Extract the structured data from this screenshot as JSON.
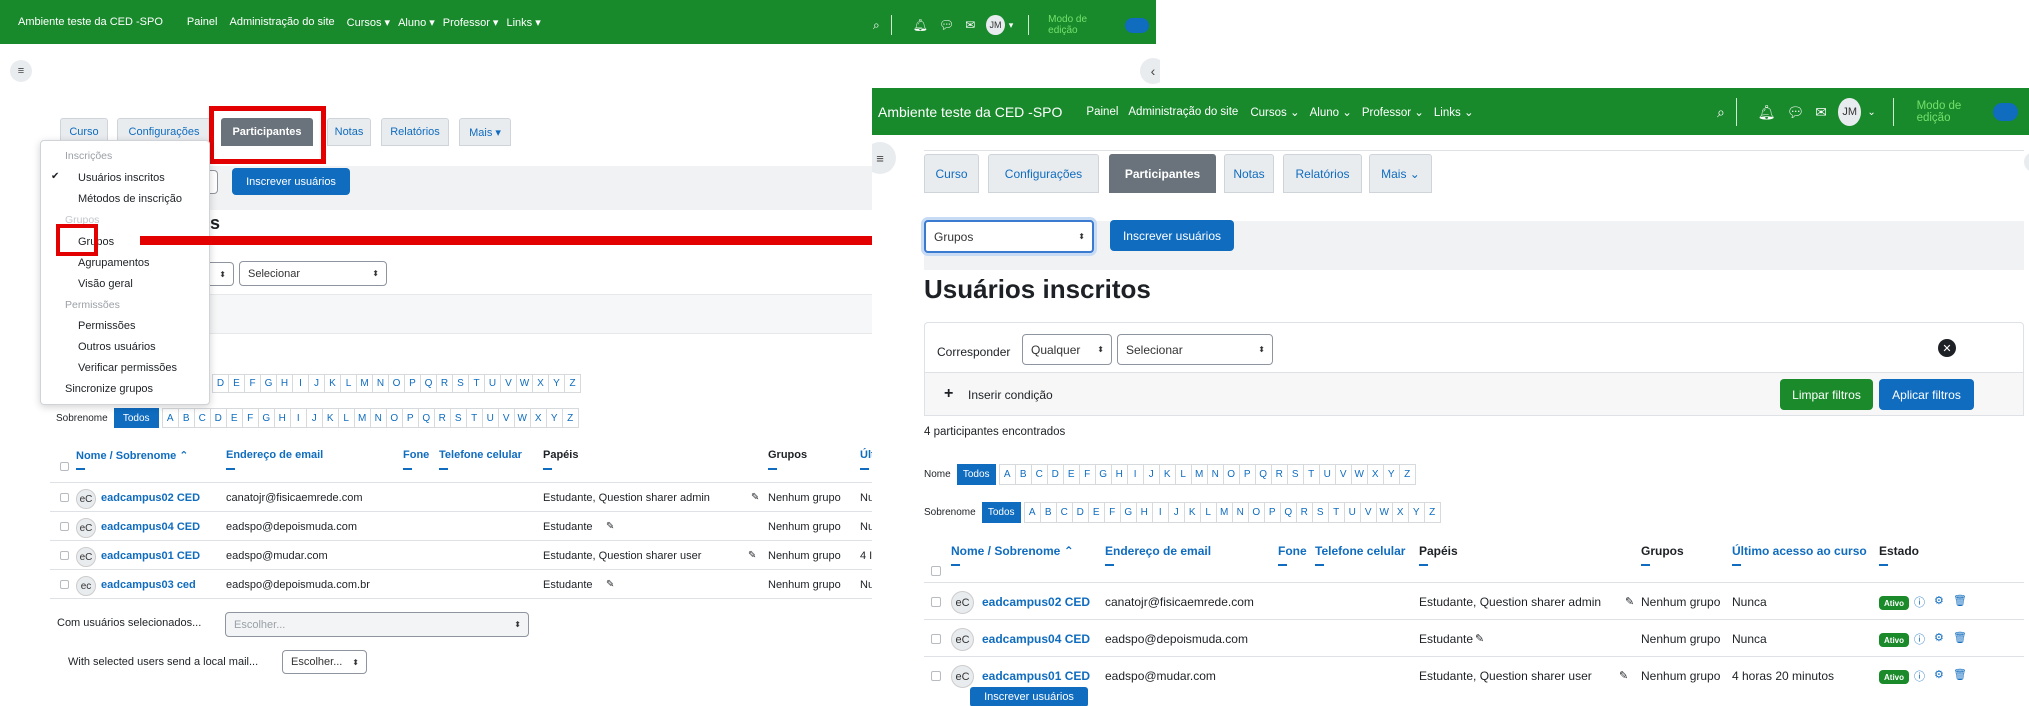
{
  "left": {
    "navbar": {
      "site_name": "Ambiente teste da CED -SPO",
      "links": [
        "Painel",
        "Administração do site",
        "Cursos ▾",
        "Aluno ▾",
        "Professor ▾",
        "Links ▾"
      ],
      "avatar": "JM",
      "edit_mode_label": "Modo de edição"
    },
    "tabs": [
      "Curso",
      "Configurações",
      "Participantes",
      "Notas",
      "Relatórios",
      "Mais ▾"
    ],
    "enrol_button": "Inscrever usuários",
    "dropdown": {
      "h1": "Inscrições",
      "i1": "Usuários inscritos",
      "i2": "Métodos de inscrição",
      "h2": "Grupos",
      "i3": "Grupos",
      "i4": "Agrupamentos",
      "i5": "Visão geral",
      "h3": "Permissões",
      "i6": "Permissões",
      "i7": "Outros usuários",
      "i8": "Verificar permissões",
      "i9": "Sincronize grupos"
    },
    "heading_tail": "s",
    "select_placeholder": "Selecionar",
    "surname_label": "Sobrenome",
    "todos": "Todos",
    "letters_partial": [
      "D",
      "E",
      "F",
      "G",
      "H",
      "I",
      "J",
      "K",
      "L",
      "M",
      "N",
      "O",
      "P",
      "Q",
      "R",
      "S",
      "T",
      "U",
      "V",
      "W",
      "X",
      "Y",
      "Z"
    ],
    "letters_full": [
      "A",
      "B",
      "C",
      "D",
      "E",
      "F",
      "G",
      "H",
      "I",
      "J",
      "K",
      "L",
      "M",
      "N",
      "O",
      "P",
      "Q",
      "R",
      "S",
      "T",
      "U",
      "V",
      "W",
      "X",
      "Y",
      "Z"
    ],
    "table": {
      "headers": {
        "name": "Nome / Sobrenome ⌃",
        "email": "Endereço de email",
        "phone": "Fone",
        "mobile": "Telefone celular",
        "roles": "Papéis",
        "groups": "Grupos",
        "last": "Últ"
      },
      "rows": [
        {
          "initials": "eC",
          "name": "eadcampus02 CED",
          "email": "canatojr@fisicaemrede.com",
          "roles": "Estudante, Question sharer admin",
          "groups": "Nenhum grupo",
          "last": "Nu"
        },
        {
          "initials": "eC",
          "name": "eadcampus04 CED",
          "email": "eadspo@depoismuda.com",
          "roles": "Estudante",
          "groups": "Nenhum grupo",
          "last": "Nu"
        },
        {
          "initials": "eC",
          "name": "eadcampus01 CED",
          "email": "eadspo@mudar.com",
          "roles": "Estudante, Question sharer user",
          "groups": "Nenhum grupo",
          "last": "4 I"
        },
        {
          "initials": "ec",
          "name": "eadcampus03 ced",
          "email": "eadspo@depoismuda.com.br",
          "roles": "Estudante",
          "groups": "Nenhum grupo",
          "last": "Nu"
        }
      ]
    },
    "selected_users_label": "Com usuários selecionados...",
    "selected_users_select": "Escolher...",
    "mail_label": "With selected users send a local mail...",
    "mail_select": "Escolher..."
  },
  "right": {
    "navbar": {
      "site_name": "Ambiente teste da CED -SPO",
      "links": [
        "Painel",
        "Administração do site",
        "Cursos ⌄",
        "Aluno ⌄",
        "Professor ⌄",
        "Links ⌄"
      ],
      "avatar": "JM",
      "edit_mode_label": "Modo de edição"
    },
    "tabs": [
      "Curso",
      "Configurações",
      "Participantes",
      "Notas",
      "Relatórios",
      "Mais ⌄"
    ],
    "groups_select": "Grupos",
    "enrol_button": "Inscrever usuários",
    "heading": "Usuários inscritos",
    "filter": {
      "match_label": "Corresponder",
      "any": "Qualquer",
      "select": "Selecionar",
      "add_condition": "Inserir condição",
      "clear": "Limpar filtros",
      "apply": "Aplicar filtros"
    },
    "count_text": "4 participantes encontrados",
    "first_name_label": "Nome",
    "surname_label": "Sobrenome",
    "todos": "Todos",
    "letters": [
      "A",
      "B",
      "C",
      "D",
      "E",
      "F",
      "G",
      "H",
      "I",
      "J",
      "K",
      "L",
      "M",
      "N",
      "O",
      "P",
      "Q",
      "R",
      "S",
      "T",
      "U",
      "V",
      "W",
      "X",
      "Y",
      "Z"
    ],
    "table": {
      "headers": {
        "name": "Nome / Sobrenome ⌃",
        "email": "Endereço de email",
        "phone": "Fone",
        "mobile": "Telefone celular",
        "roles": "Papéis",
        "groups": "Grupos",
        "last": "Último acesso ao curso",
        "status": "Estado"
      },
      "rows": [
        {
          "initials": "eC",
          "name": "eadcampus02 CED",
          "email": "canatojr@fisicaemrede.com",
          "roles": "Estudante, Question sharer admin",
          "groups": "Nenhum grupo",
          "last": "Nunca",
          "status": "Ativo"
        },
        {
          "initials": "eC",
          "name": "eadcampus04 CED",
          "email": "eadspo@depoismuda.com",
          "roles": "Estudante",
          "groups": "Nenhum grupo",
          "last": "Nunca",
          "status": "Ativo"
        },
        {
          "initials": "eC",
          "name": "eadcampus01 CED",
          "email": "eadspo@mudar.com",
          "roles": "Estudante, Question sharer user",
          "groups": "Nenhum grupo",
          "last": "4 horas 20 minutos",
          "status": "Ativo"
        }
      ]
    },
    "bottom_button": "Inscrever usuários"
  }
}
